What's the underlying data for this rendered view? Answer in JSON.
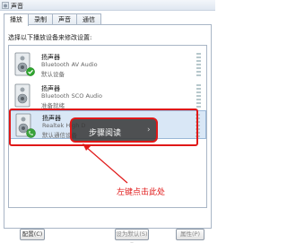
{
  "window": {
    "title": "声音"
  },
  "tabs": [
    {
      "label": "播放",
      "active": true
    },
    {
      "label": "录制",
      "active": false
    },
    {
      "label": "声音",
      "active": false
    },
    {
      "label": "通信",
      "active": false
    }
  ],
  "instruction": "选择以下播放设备来修改设置:",
  "devices": [
    {
      "name": "扬声器",
      "description": "Bluetooth AV Audio",
      "status": "默认设备",
      "badge": "check-icon"
    },
    {
      "name": "扬声器",
      "description": "Bluetooth SCO Audio",
      "status": "准备就绪",
      "badge": "none"
    },
    {
      "name": "扬声器",
      "description": "Realtek High D",
      "status": "默认通信设备",
      "badge": "phone-icon",
      "selected": true
    }
  ],
  "overlay": {
    "text": "步骤阅读",
    "arrow": "›"
  },
  "annotation": "左键点击此处",
  "buttons": {
    "configure": "配置(C)",
    "set_default": "设为默认(S) ▾",
    "properties": "属性(P)"
  },
  "colors": {
    "highlight": "#e01818",
    "selection": "#d9e7f6",
    "check_badge": "#2ea52e"
  }
}
